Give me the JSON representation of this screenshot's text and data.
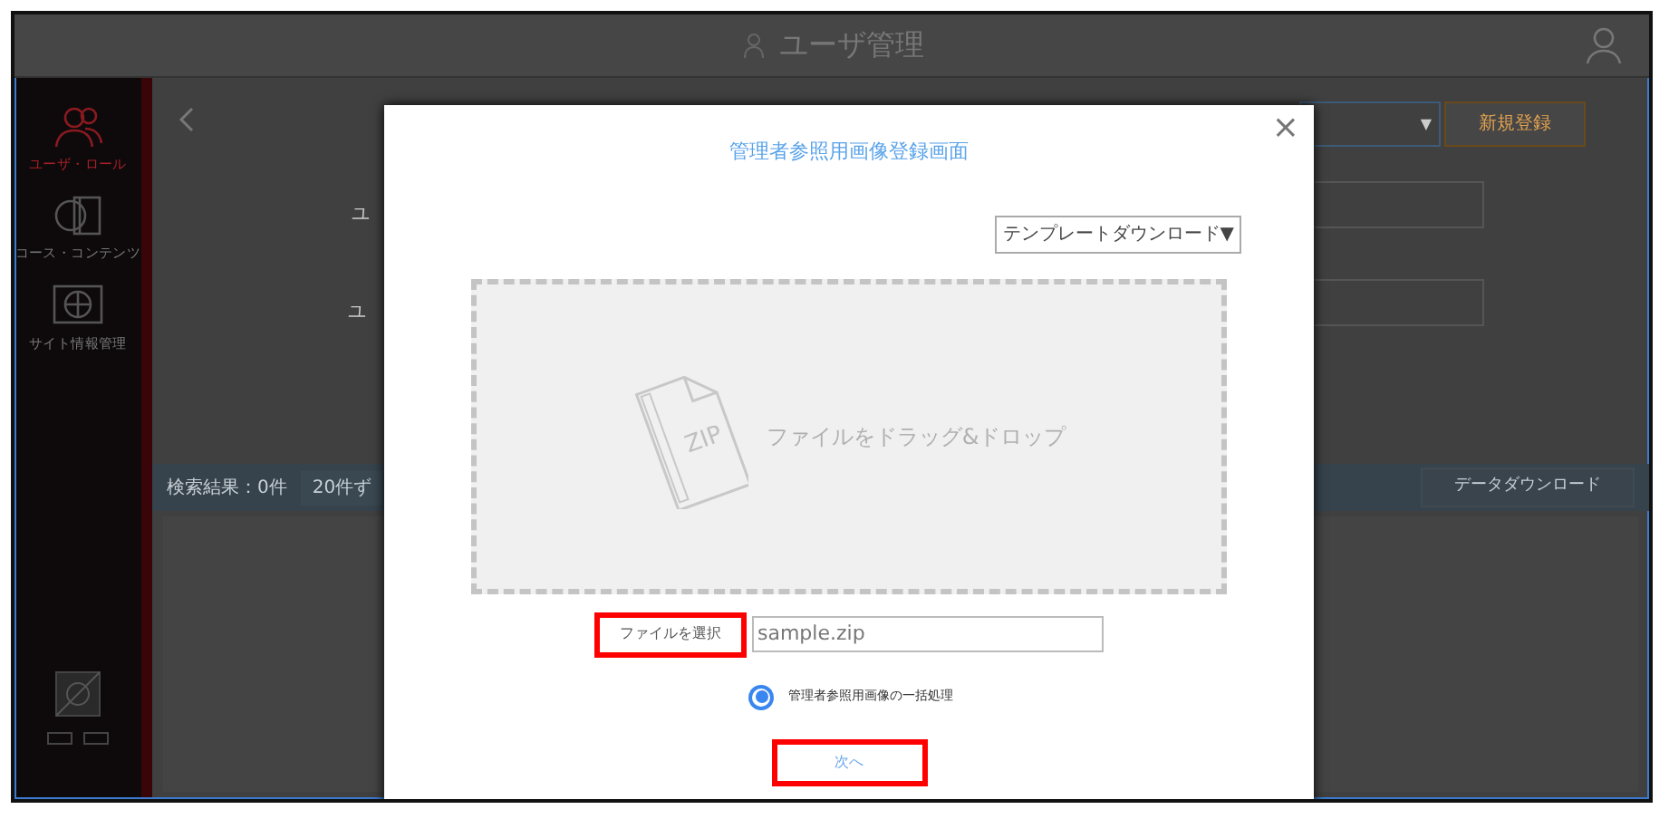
{
  "header": {
    "title": "ユーザ管理"
  },
  "sidebar": {
    "items": [
      {
        "label": "ユーザ・ロール",
        "selected": true
      },
      {
        "label": "コース・コンテンツ",
        "selected": false
      },
      {
        "label": "サイト情報管理",
        "selected": false
      }
    ]
  },
  "main": {
    "filter_caret": "▼",
    "new_button": "新規登録",
    "field_labels": [
      "ユ",
      "ユ"
    ],
    "result_count": "検索結果：0件",
    "page_size": "20件ず",
    "download_button": "データダウンロード"
  },
  "dialog": {
    "title": "管理者参照用画像登録画面",
    "close": "×",
    "template_button": "テンプレートダウンロード▼",
    "drop_zone": {
      "text": "ファイルをドラッグ&ドロップ",
      "badge": "ZIP"
    },
    "file_button": {
      "label": "ファイルを選択",
      "highlighted": true
    },
    "file_name": "sample.zip",
    "options": [
      {
        "label": "管理者参照用画像の一括処理",
        "selected": true
      }
    ],
    "next_button": {
      "label": "次へ",
      "highlighted": true
    }
  }
}
